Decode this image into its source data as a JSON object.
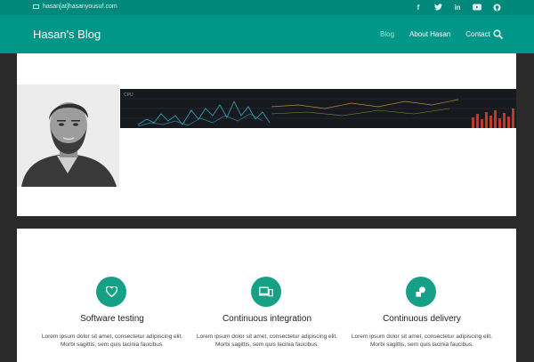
{
  "topbar": {
    "email": "hasan[at]hasanyousuf.com",
    "social_icons": [
      "facebook-icon",
      "twitter-icon",
      "linkedin-icon",
      "youtube-icon",
      "github-icon"
    ]
  },
  "header": {
    "brand": "Hasan's Blog",
    "nav": [
      {
        "label": "Blog",
        "active": true
      },
      {
        "label": "About Hasan",
        "active": false
      },
      {
        "label": "Contact",
        "active": false
      }
    ]
  },
  "banner": {
    "label": "CPU"
  },
  "features": [
    {
      "icon": "heart-icon",
      "title": "Software testing",
      "desc": "Lorem ipsum dolor sit amet, consectetur adipiscing elit. Morbi sagittis, sem quis lacinia faucibus."
    },
    {
      "icon": "devices-icon",
      "title": "Continuous integration",
      "desc": "Lorem ipsum dolor sit amet, consectetur adipiscing elit. Morbi sagittis, sem quis lacinia faucibus."
    },
    {
      "icon": "shapes-icon",
      "title": "Continuous delivery",
      "desc": "Lorem ipsum dolor sit amet, consectetur adipiscing elit. Morbi sagittis, sem quis lacinia faucibus."
    }
  ],
  "colors": {
    "accent": "#009688",
    "accent_dark": "#00897b",
    "icon_bg": "#16a085"
  }
}
